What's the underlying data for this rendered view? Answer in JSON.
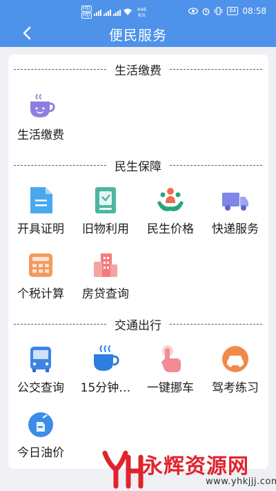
{
  "status_bar": {
    "hd1": "HD",
    "hd2": "HD",
    "speed_value": "446",
    "speed_unit": "K/s",
    "battery": "84",
    "time": "08:58"
  },
  "header": {
    "back_icon": "chevron-left-icon",
    "title": "便民服务"
  },
  "sections": [
    {
      "title": "生活缴费",
      "items": [
        {
          "label": "生活缴费",
          "icon": "hot-cup-icon"
        }
      ]
    },
    {
      "title": "民生保障",
      "items": [
        {
          "label": "开具证明",
          "icon": "document-icon"
        },
        {
          "label": "旧物利用",
          "icon": "recycle-box-icon"
        },
        {
          "label": "民生价格",
          "icon": "people-hands-icon"
        },
        {
          "label": "快递服务",
          "icon": "truck-icon"
        },
        {
          "label": "个税计算",
          "icon": "calculator-icon"
        },
        {
          "label": "房贷查询",
          "icon": "building-icon"
        }
      ]
    },
    {
      "title": "交通出行",
      "items": [
        {
          "label": "公交查询",
          "icon": "bus-icon"
        },
        {
          "label": "15分钟…",
          "icon": "coffee-cup-icon"
        },
        {
          "label": "一键挪车",
          "icon": "tap-hand-icon"
        },
        {
          "label": "驾考练习",
          "icon": "car-badge-icon"
        },
        {
          "label": "今日油价",
          "icon": "oil-drop-icon"
        }
      ]
    }
  ],
  "watermark": {
    "text": "永辉资源网",
    "url": "www.yhkjjj.com",
    "logo_icon": "yh-logo-icon"
  },
  "colors": {
    "header": "#4e92ea",
    "background": "#eef0f4",
    "card": "#ffffff",
    "watermark": "#e0242e"
  }
}
